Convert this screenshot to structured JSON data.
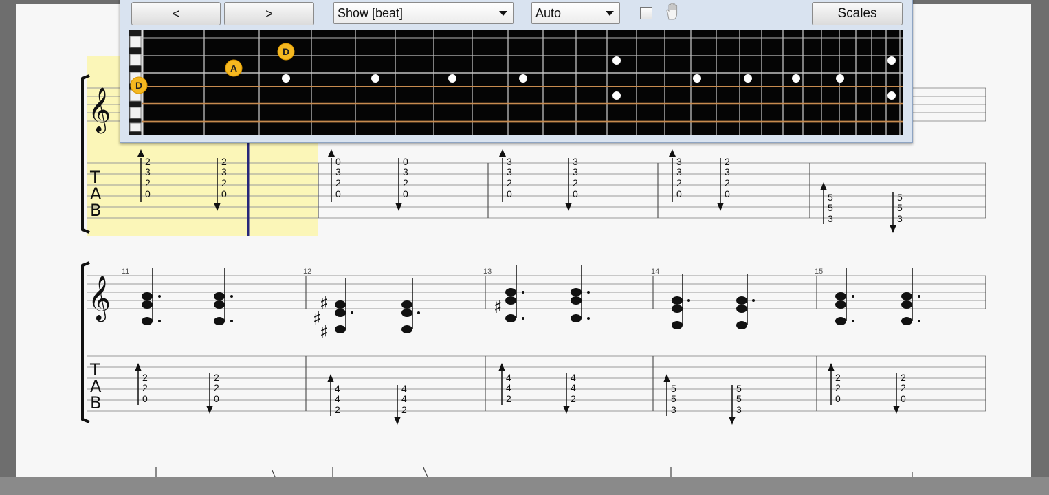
{
  "toolbar": {
    "prev_label": "<",
    "next_label": ">",
    "show_value": "Show [beat]",
    "mode_value": "Auto",
    "scales_label": "Scales"
  },
  "fretboard": {
    "markers": [
      {
        "note": "D",
        "string": 4,
        "fret": 0
      },
      {
        "note": "A",
        "string": 3,
        "fret": 2
      },
      {
        "note": "D",
        "string": 2,
        "fret": 3
      }
    ]
  },
  "system1": {
    "measures": [
      {
        "chords": [
          [
            "2",
            "3",
            "2",
            "0"
          ],
          [
            "2",
            "3",
            "2",
            "0"
          ]
        ]
      },
      {
        "chords": [
          [
            "0",
            "3",
            "2",
            "0"
          ],
          [
            "0",
            "3",
            "2",
            "0"
          ]
        ]
      },
      {
        "chords": [
          [
            "3",
            "3",
            "2",
            "0"
          ],
          [
            "3",
            "3",
            "2",
            "0"
          ]
        ]
      },
      {
        "chords": [
          [
            "3",
            "3",
            "2",
            "0"
          ],
          [
            "2",
            "3",
            "2",
            "0"
          ]
        ]
      },
      {
        "chords": [
          [
            "5",
            "5",
            "3"
          ],
          [
            "5",
            "5",
            "3"
          ]
        ]
      }
    ]
  },
  "system2": {
    "measures": [
      {
        "number": "11",
        "chords": [
          [
            "2",
            "2",
            "0"
          ],
          [
            "2",
            "2",
            "0"
          ]
        ]
      },
      {
        "number": "12",
        "chords": [
          [
            "4",
            "4",
            "2"
          ],
          [
            "4",
            "4",
            "2"
          ]
        ]
      },
      {
        "number": "13",
        "chords": [
          [
            "4",
            "4",
            "2"
          ],
          [
            "4",
            "4",
            "2"
          ]
        ]
      },
      {
        "number": "14",
        "chords": [
          [
            "5",
            "5",
            "3"
          ],
          [
            "5",
            "5",
            "3"
          ]
        ]
      },
      {
        "number": "15",
        "chords": [
          [
            "2",
            "2",
            "0"
          ],
          [
            "2",
            "2",
            "0"
          ]
        ]
      }
    ]
  },
  "tab_clef": [
    "T",
    "A",
    "B"
  ]
}
